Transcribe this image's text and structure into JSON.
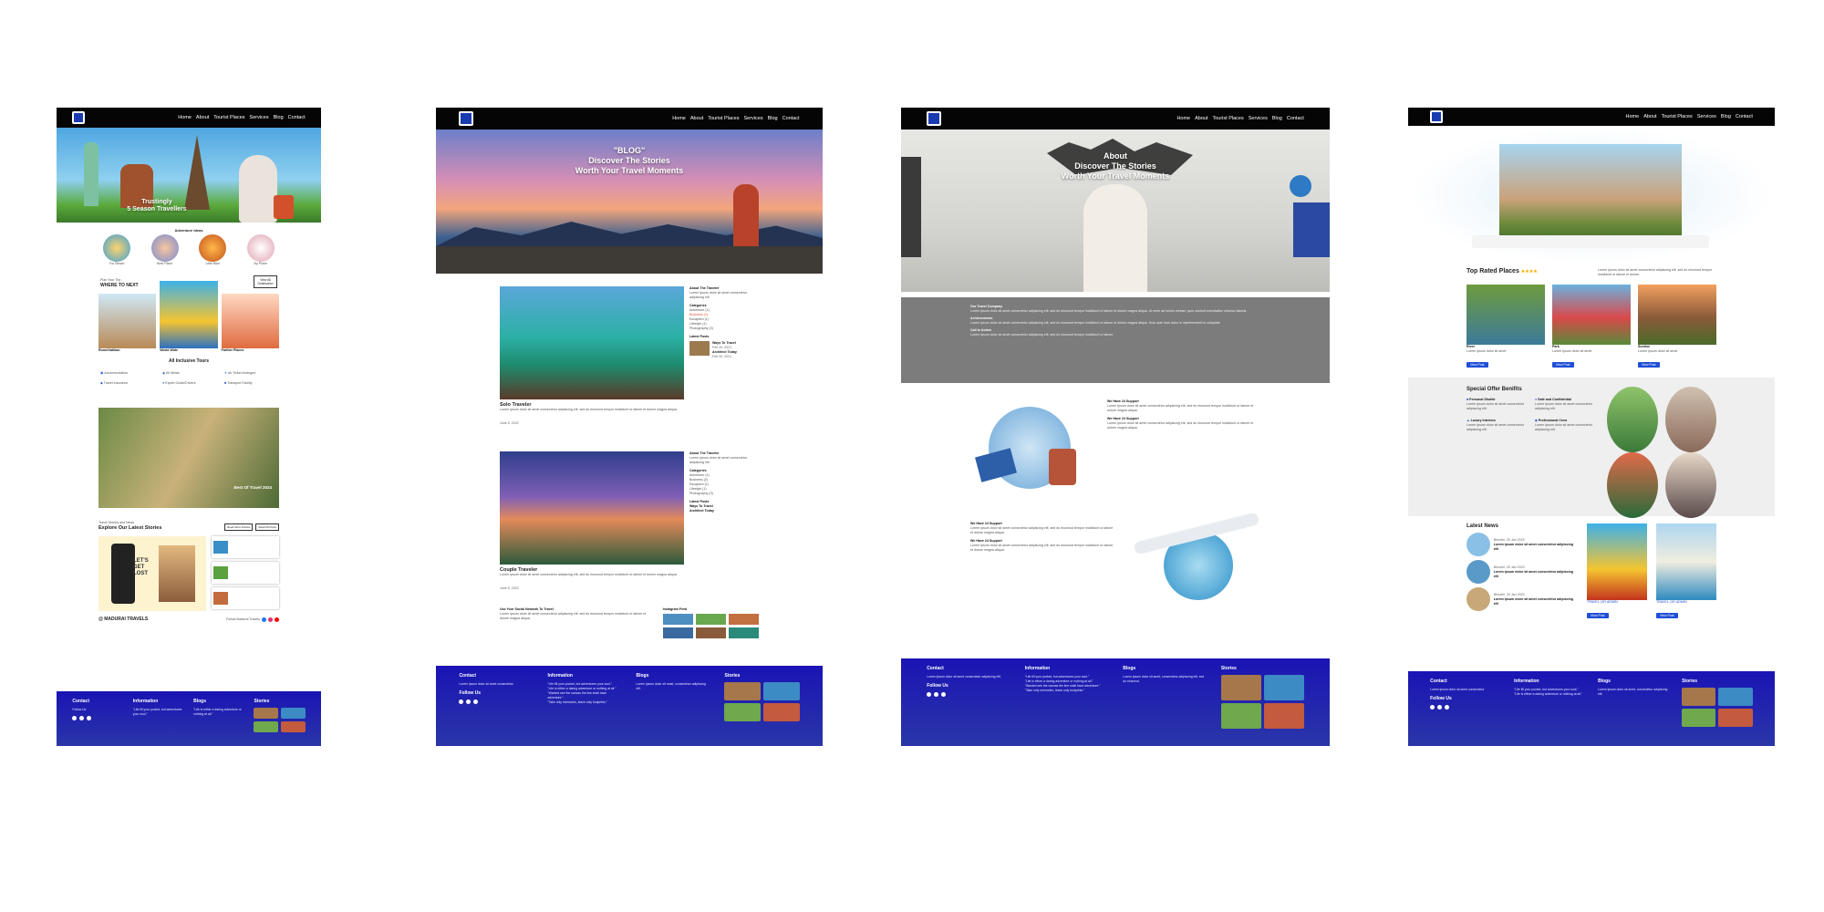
{
  "nav": {
    "links_short": [
      "Home",
      "About",
      "Tourist Places",
      "Services",
      "Blog",
      "Contact"
    ]
  },
  "page1": {
    "hero_lines": [
      "Trustingly",
      "5 Season Travellers"
    ],
    "adventure_title": "Adventure Ideas",
    "adventures": [
      {
        "name": "For Beach"
      },
      {
        "name": "Best Place"
      },
      {
        "name": "Little Bike"
      },
      {
        "name": "By Plane"
      }
    ],
    "plan_label": "Plan Your Trip",
    "where_title": "WHERE TO NEXT",
    "where_button": "View All Destination",
    "destinations": [
      "Rome/Vatikan",
      "World Wide",
      "Farther Places"
    ],
    "inclusive_title": "All Inclusive Tours",
    "features": [
      "Accommodation",
      "All Meals",
      "Air Ticket Arranged",
      "Travel Insurance",
      "Expert Guide/Drivers",
      "Transport Facility"
    ],
    "video_title": "Best Of Travel 2024",
    "news_label": "Travel Stories and News",
    "news_title": "Explore Our Latest Stories",
    "news_buttons": [
      "Read More Articles",
      "Read All Posts"
    ],
    "poster_text": "LET'S GET LOST",
    "brand": "@ MADURAI TRAVELS",
    "follow": "Follow Madurai Travels"
  },
  "page2": {
    "hero_lines": [
      "\"BLOG\"",
      "Discover The Stories",
      "Worth Your Travel Moments"
    ],
    "posts": [
      {
        "title": "Solo Traveler",
        "date": "June 5, 2022"
      },
      {
        "title": "Couple Traveler",
        "date": "June 5, 2022"
      }
    ],
    "sidebar": {
      "about": "About The Traveler",
      "categories_title": "Categories",
      "categories": [
        "Adventure (1)",
        "Business (2)",
        "Escapism (1)",
        "Lifestyle (1)",
        "Photography (3)"
      ],
      "latest_title": "Latest Posts",
      "latest": [
        "Ways To Travel",
        "Architect Today"
      ],
      "latest_dates": [
        "Feb 20, 2021",
        "Feb 20, 2021"
      ]
    },
    "social_title": "Use Your Social Network To Travel",
    "instagram_title": "Instagram Feed"
  },
  "page3": {
    "hero_lines": [
      "About",
      "Discover The Stories",
      "Worth Your Travel Moments"
    ],
    "sections": [
      "Our Travel Company",
      "Achievements",
      "Call to Action"
    ],
    "support": [
      "We Have 24 Support",
      "We Have 24 Support",
      "We Have 24 Support",
      "We Have 24 Support"
    ]
  },
  "page4": {
    "top_rated_title": "Top Rated Places",
    "stars": "★★★★",
    "places": [
      {
        "name": "River",
        "button": "View Post"
      },
      {
        "name": "Park",
        "button": "View Post"
      },
      {
        "name": "Sunrise",
        "button": "View Post"
      }
    ],
    "offer_title": "Special Offer Benifits",
    "offers": [
      "Personal Shuttle",
      "Safe and Confidential",
      "Luxury Interiors",
      "Professional Crew"
    ],
    "news_title": "Latest News",
    "news_items": [
      "Bhoothi, 20 Jan 2023",
      "Bhoothi, 20 Jan 2023",
      "Bhoothi, 20 Jan 2023"
    ],
    "news_cards": [
      {
        "caption": "TRAVEL | BY ADMIN",
        "button": "View Post"
      },
      {
        "caption": "TRAVEL | BY ADMIN",
        "button": "View Post"
      }
    ]
  },
  "footer": {
    "headings": [
      "Contact",
      "Information",
      "Blogs",
      "Stories"
    ],
    "follow": "Follow Us",
    "info_lines": [
      "\"Life fill your pocket, but adventures your soul.\"",
      "\"Life is either a daring adventure or nothing at all.\"",
      "\"Wanted see the canvas the line shall have adventure.\"",
      "\"Take only memories, leave only footprints.\""
    ]
  }
}
